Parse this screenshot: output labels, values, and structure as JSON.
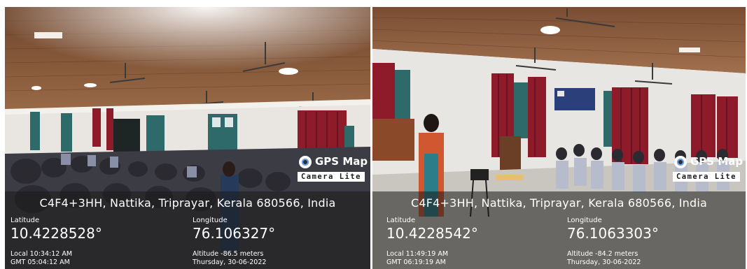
{
  "photos": [
    {
      "brand": "GPS Map",
      "brand_sub": "Camera Lite",
      "address": "C4F4+3HH, Nattika, Triprayar, Kerala 680566, India",
      "latitude_label": "Latitude",
      "latitude": "10.4228528°",
      "longitude_label": "Longitude",
      "longitude": "76.106327°",
      "local_time": "Local 10:34:12 AM",
      "gmt_time": "GMT 05:04:12 AM",
      "altitude": "Altitude -86.5 meters",
      "date": "Thursday, 30-06-2022"
    },
    {
      "brand": "GPS Map",
      "brand_sub": "Camera Lite",
      "address": "C4F4+3HH, Nattika, Triprayar, Kerala 680566, India",
      "latitude_label": "Latitude",
      "latitude": "10.4228542°",
      "longitude_label": "Longitude",
      "longitude": "76.1063303°",
      "local_time": "Local 11:49:19 AM",
      "gmt_time": "GMT 06:19:19 AM",
      "altitude": "Altitude -84.2 meters",
      "date": "Thursday, 30-06-2022"
    }
  ],
  "colors": {
    "ceiling": "#8a5a3c",
    "wall": "#e7e4df",
    "curtain": "#8e1b2a",
    "door": "#2f6a6a",
    "overlay": "#191919"
  }
}
